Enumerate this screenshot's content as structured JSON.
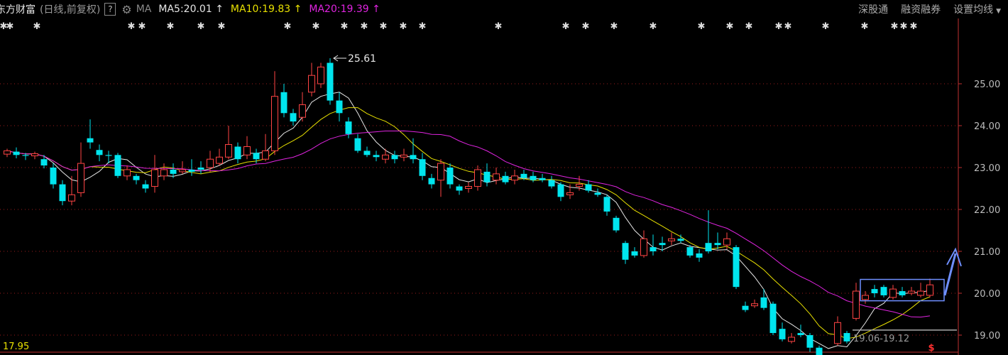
{
  "header": {
    "stock_name": "东方财富",
    "adjust_mode": "(日线,前复权)",
    "help": "?",
    "ma_label": "MA",
    "ma5": "MA5:20.01",
    "ma10": "MA10:19.83",
    "ma20": "MA20:19.39",
    "arrow": "↑"
  },
  "menu": {
    "item1": "深股通",
    "item2": "融资融券",
    "item3": "设置均线"
  },
  "bottom_value": "17.95",
  "colors": {
    "up": "#ff4444",
    "down": "#00e5ee",
    "ma5": "#e6e6e6",
    "ma10": "#e8e000",
    "ma20": "#e024e0",
    "box": "#6f8fff"
  },
  "chart_data": {
    "type": "candlestick",
    "y_axis_ticks": [
      "25.00",
      "24.00",
      "23.00",
      "22.00",
      "21.00",
      "20.00",
      "19.00"
    ],
    "ylim": [
      17.8,
      26.0
    ],
    "grid": true,
    "annotations": {
      "high": "25.61",
      "low": "18.25",
      "range": "19.06-19.12",
      "marker": "$"
    },
    "candles": [
      [
        23.32,
        23.4,
        23.45,
        23.25
      ],
      [
        23.38,
        23.3,
        23.48,
        23.22
      ],
      [
        23.3,
        23.28,
        23.35,
        23.18
      ],
      [
        23.28,
        23.33,
        23.38,
        23.2
      ],
      [
        23.2,
        23.05,
        23.3,
        22.98
      ],
      [
        23.0,
        22.6,
        23.1,
        22.5
      ],
      [
        22.6,
        22.2,
        22.7,
        22.1
      ],
      [
        22.2,
        22.35,
        22.8,
        22.1
      ],
      [
        22.4,
        23.1,
        23.6,
        22.3
      ],
      [
        23.7,
        23.6,
        24.15,
        23.45
      ],
      [
        23.42,
        23.3,
        23.55,
        23.15
      ],
      [
        23.3,
        23.28,
        23.4,
        23.1
      ],
      [
        23.3,
        22.8,
        23.35,
        22.75
      ],
      [
        22.8,
        22.95,
        23.05,
        22.7
      ],
      [
        22.8,
        22.7,
        22.85,
        22.6
      ],
      [
        22.6,
        22.5,
        22.7,
        22.4
      ],
      [
        22.55,
        22.95,
        23.3,
        22.4
      ],
      [
        22.8,
        22.95,
        23.1,
        22.7
      ],
      [
        22.95,
        22.85,
        23.1,
        22.75
      ],
      [
        22.9,
        22.95,
        23.15,
        22.85
      ],
      [
        22.95,
        22.9,
        23.2,
        22.8
      ],
      [
        23.0,
        22.95,
        23.15,
        22.85
      ],
      [
        23.0,
        23.2,
        23.4,
        22.9
      ],
      [
        23.1,
        23.25,
        23.45,
        23.05
      ],
      [
        23.25,
        23.55,
        24.0,
        23.2
      ],
      [
        23.5,
        23.2,
        23.6,
        23.1
      ],
      [
        23.3,
        23.5,
        23.75,
        23.2
      ],
      [
        23.35,
        23.2,
        23.45,
        23.1
      ],
      [
        23.2,
        23.4,
        23.8,
        23.15
      ],
      [
        23.4,
        24.7,
        25.3,
        23.3
      ],
      [
        24.8,
        24.3,
        25.0,
        24.2
      ],
      [
        24.3,
        24.1,
        24.4,
        24.0
      ],
      [
        24.2,
        24.5,
        24.8,
        24.1
      ],
      [
        24.8,
        25.2,
        25.5,
        24.7
      ],
      [
        25.0,
        25.4,
        25.5,
        24.9
      ],
      [
        25.5,
        24.6,
        25.61,
        24.5
      ],
      [
        24.6,
        24.3,
        24.8,
        24.1
      ],
      [
        24.1,
        23.8,
        24.2,
        23.7
      ],
      [
        23.7,
        23.4,
        23.8,
        23.35
      ],
      [
        23.4,
        23.3,
        23.5,
        23.25
      ],
      [
        23.3,
        23.25,
        23.4,
        23.15
      ],
      [
        23.2,
        23.3,
        23.45,
        23.1
      ],
      [
        23.3,
        23.2,
        23.4,
        23.1
      ],
      [
        23.25,
        23.3,
        23.45,
        23.15
      ],
      [
        23.3,
        23.2,
        23.7,
        23.1
      ],
      [
        23.2,
        22.8,
        23.35,
        22.7
      ],
      [
        22.75,
        22.6,
        22.85,
        22.5
      ],
      [
        22.7,
        23.1,
        23.2,
        22.3
      ],
      [
        23.0,
        22.6,
        23.1,
        22.5
      ],
      [
        22.55,
        22.45,
        22.6,
        22.35
      ],
      [
        22.5,
        22.55,
        22.65,
        22.4
      ],
      [
        22.55,
        22.95,
        23.05,
        22.45
      ],
      [
        22.9,
        22.65,
        23.1,
        22.55
      ],
      [
        22.7,
        22.85,
        23.0,
        22.6
      ],
      [
        22.8,
        22.65,
        22.9,
        22.6
      ],
      [
        22.7,
        22.8,
        22.95,
        22.6
      ],
      [
        22.85,
        22.75,
        22.95,
        22.7
      ],
      [
        22.8,
        22.7,
        22.9,
        22.65
      ],
      [
        22.75,
        22.7,
        22.85,
        22.65
      ],
      [
        22.7,
        22.55,
        22.8,
        22.5
      ],
      [
        22.6,
        22.3,
        22.65,
        22.2
      ],
      [
        22.35,
        22.4,
        22.6,
        22.25
      ],
      [
        22.55,
        22.6,
        22.8,
        22.45
      ],
      [
        22.6,
        22.45,
        22.7,
        22.4
      ],
      [
        22.4,
        22.35,
        22.5,
        22.3
      ],
      [
        22.3,
        21.95,
        22.35,
        21.85
      ],
      [
        21.8,
        21.5,
        21.85,
        21.45
      ],
      [
        21.2,
        20.8,
        21.25,
        20.7
      ],
      [
        21.0,
        20.9,
        21.1,
        20.85
      ],
      [
        20.9,
        21.3,
        21.5,
        20.85
      ],
      [
        21.1,
        21.0,
        21.4,
        20.9
      ],
      [
        21.2,
        21.15,
        21.35,
        21.0
      ],
      [
        21.25,
        21.3,
        21.45,
        21.15
      ],
      [
        21.3,
        21.25,
        21.4,
        21.2
      ],
      [
        21.1,
        20.9,
        21.15,
        20.85
      ],
      [
        20.95,
        20.85,
        21.05,
        20.75
      ],
      [
        21.2,
        21.0,
        21.98,
        20.95
      ],
      [
        21.2,
        21.15,
        21.45,
        21.05
      ],
      [
        21.15,
        21.3,
        21.45,
        21.05
      ],
      [
        21.1,
        20.15,
        21.15,
        20.1
      ],
      [
        19.7,
        19.6,
        19.8,
        19.55
      ],
      [
        19.7,
        19.75,
        19.85,
        19.65
      ],
      [
        19.9,
        19.65,
        20.1,
        19.6
      ],
      [
        19.75,
        19.05,
        19.8,
        19.0
      ],
      [
        19.15,
        18.9,
        19.3,
        18.85
      ],
      [
        18.85,
        18.95,
        19.05,
        18.8
      ],
      [
        19.05,
        19.0,
        19.25,
        18.95
      ],
      [
        19.0,
        18.7,
        19.05,
        18.6
      ],
      [
        18.7,
        18.45,
        18.75,
        18.4
      ],
      [
        18.35,
        18.3,
        18.4,
        18.25
      ],
      [
        18.8,
        19.3,
        19.45,
        18.75
      ],
      [
        19.05,
        18.85,
        19.1,
        18.8
      ],
      [
        19.4,
        20.05,
        20.25,
        19.35
      ],
      [
        19.85,
        19.95,
        20.05,
        19.75
      ],
      [
        20.1,
        20.0,
        20.2,
        19.9
      ],
      [
        20.15,
        19.95,
        20.2,
        19.9
      ],
      [
        19.9,
        20.1,
        20.2,
        19.85
      ],
      [
        20.05,
        19.95,
        20.15,
        19.9
      ],
      [
        20.0,
        20.05,
        20.15,
        19.95
      ],
      [
        19.95,
        20.05,
        20.25,
        19.9
      ],
      [
        19.95,
        20.2,
        20.35,
        19.9
      ]
    ]
  }
}
